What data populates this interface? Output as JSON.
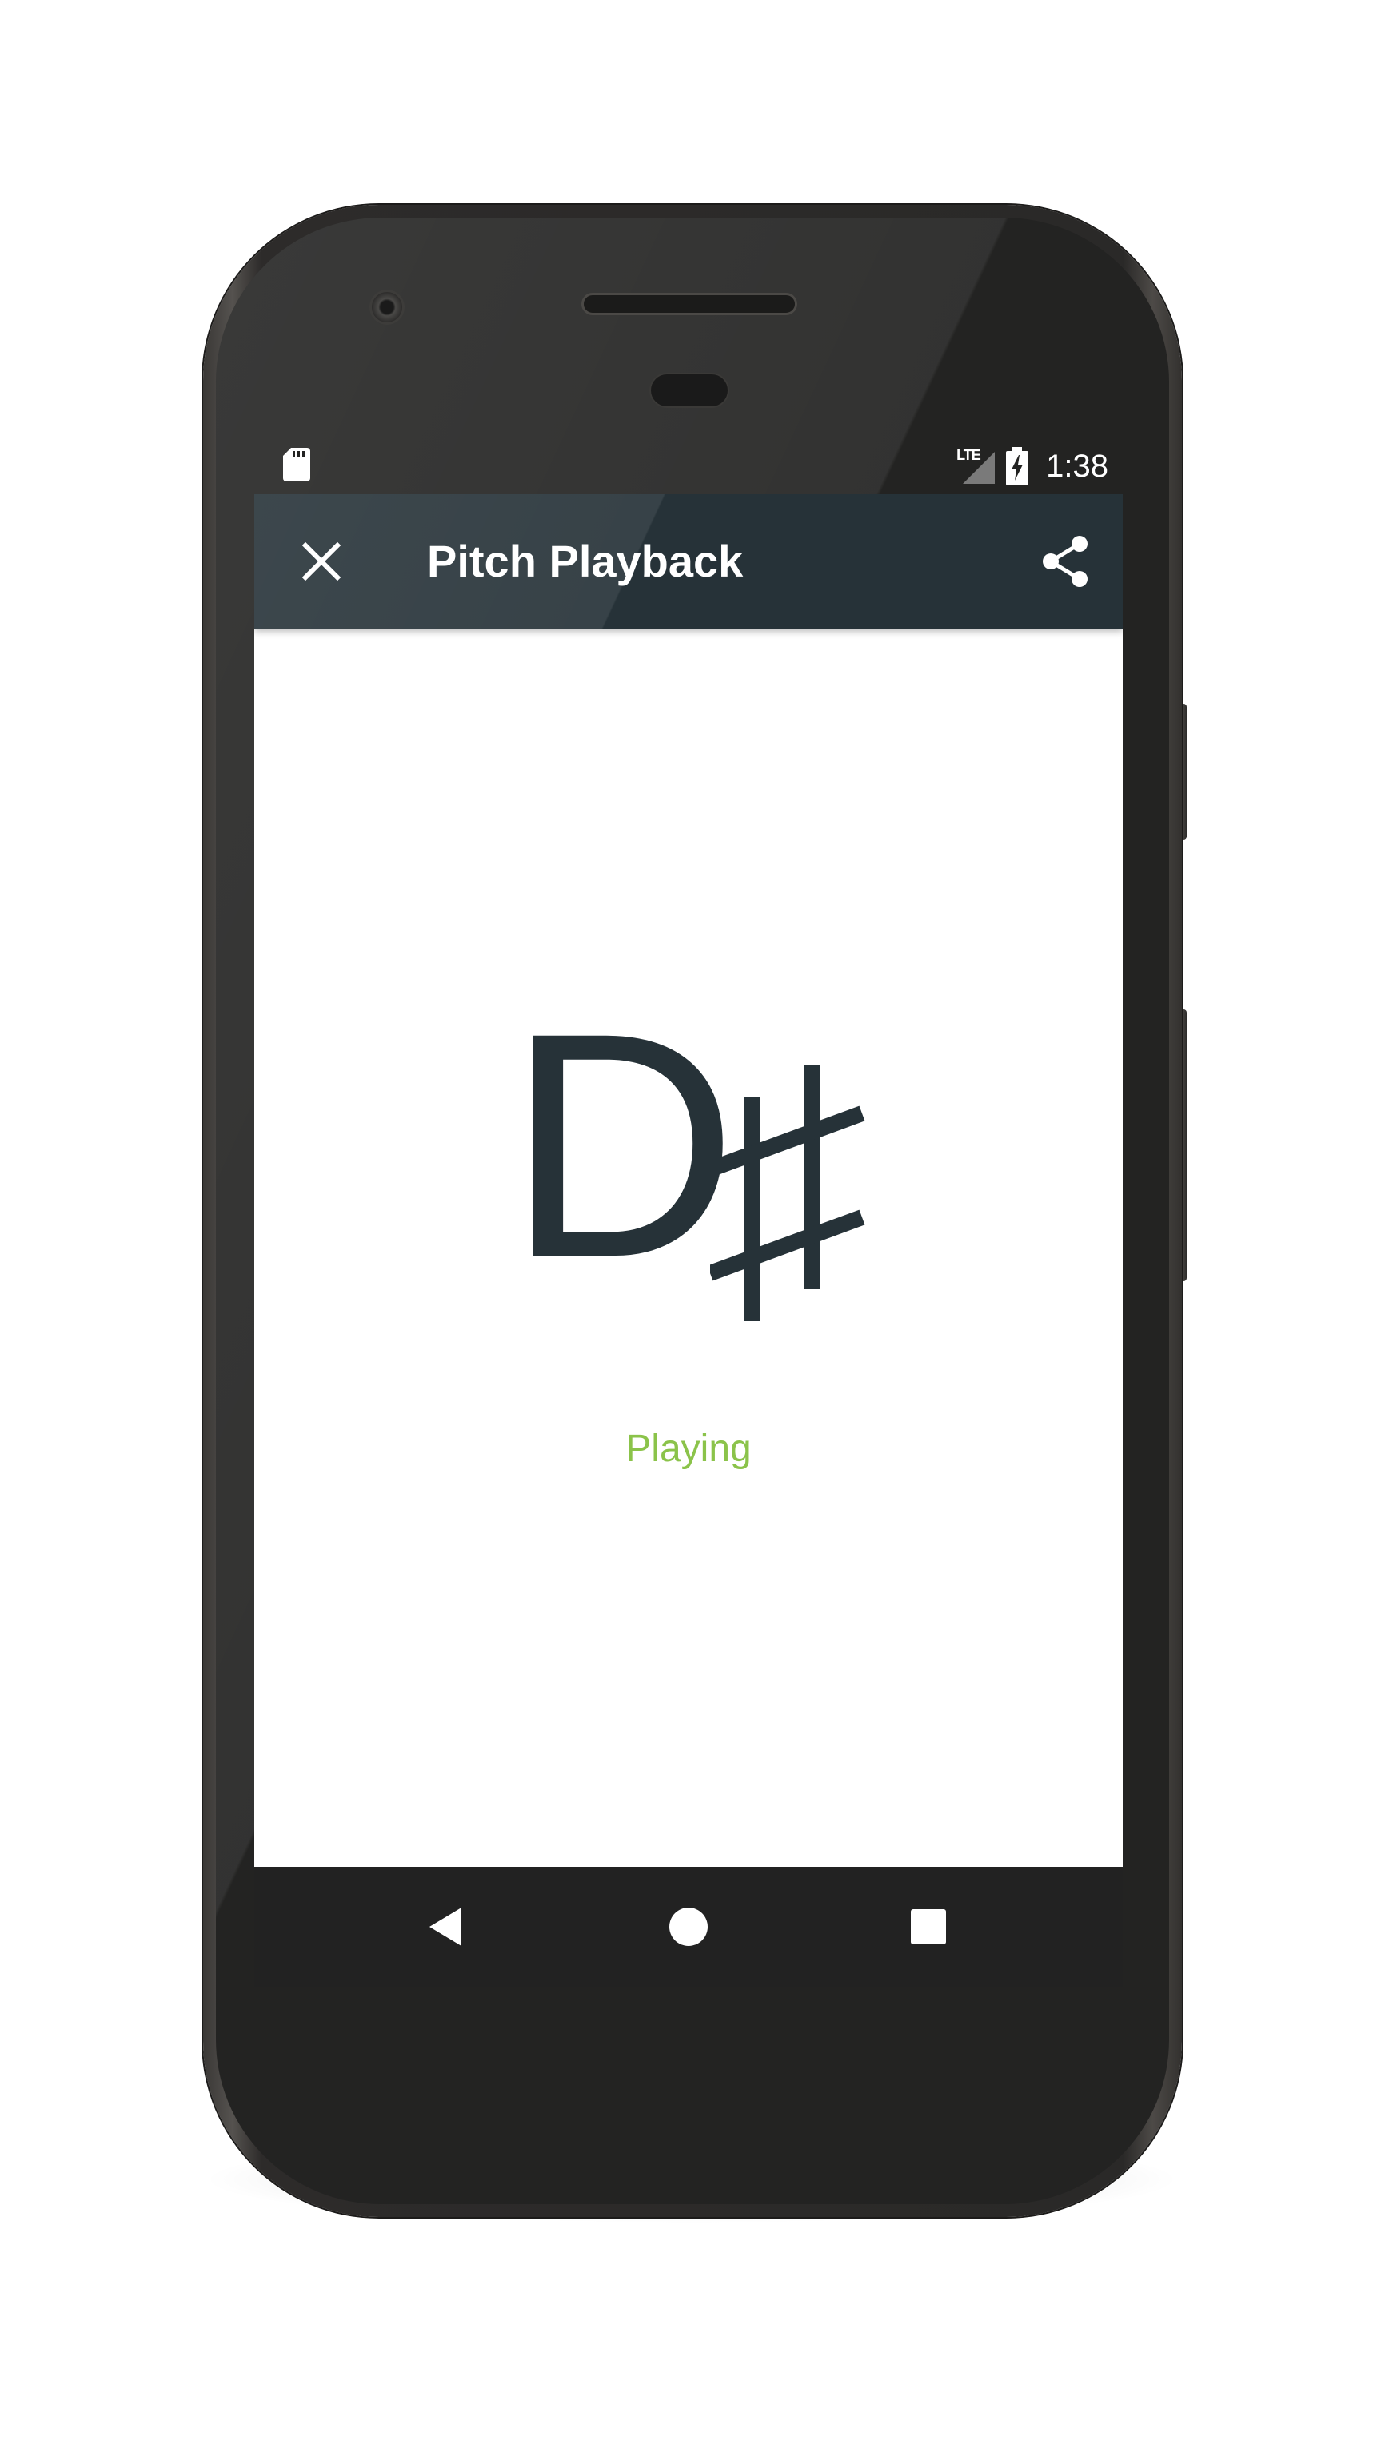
{
  "status_bar": {
    "time": "1:38",
    "network": "LTE",
    "icons": [
      "sd-card-icon",
      "signal-icon",
      "battery-charging-icon"
    ]
  },
  "app_bar": {
    "title": "Pitch Playback",
    "close_icon": "close-icon",
    "share_icon": "share-icon"
  },
  "pitch": {
    "note": "D",
    "accidental": "♯",
    "status": "Playing"
  },
  "nav_bar": {
    "back_icon": "back-icon",
    "home_icon": "home-icon",
    "recents_icon": "recents-icon"
  },
  "colors": {
    "app_bar": "#263238",
    "note_text": "#263238",
    "status_text": "#8bc34a",
    "nav_bar": "#222222"
  }
}
